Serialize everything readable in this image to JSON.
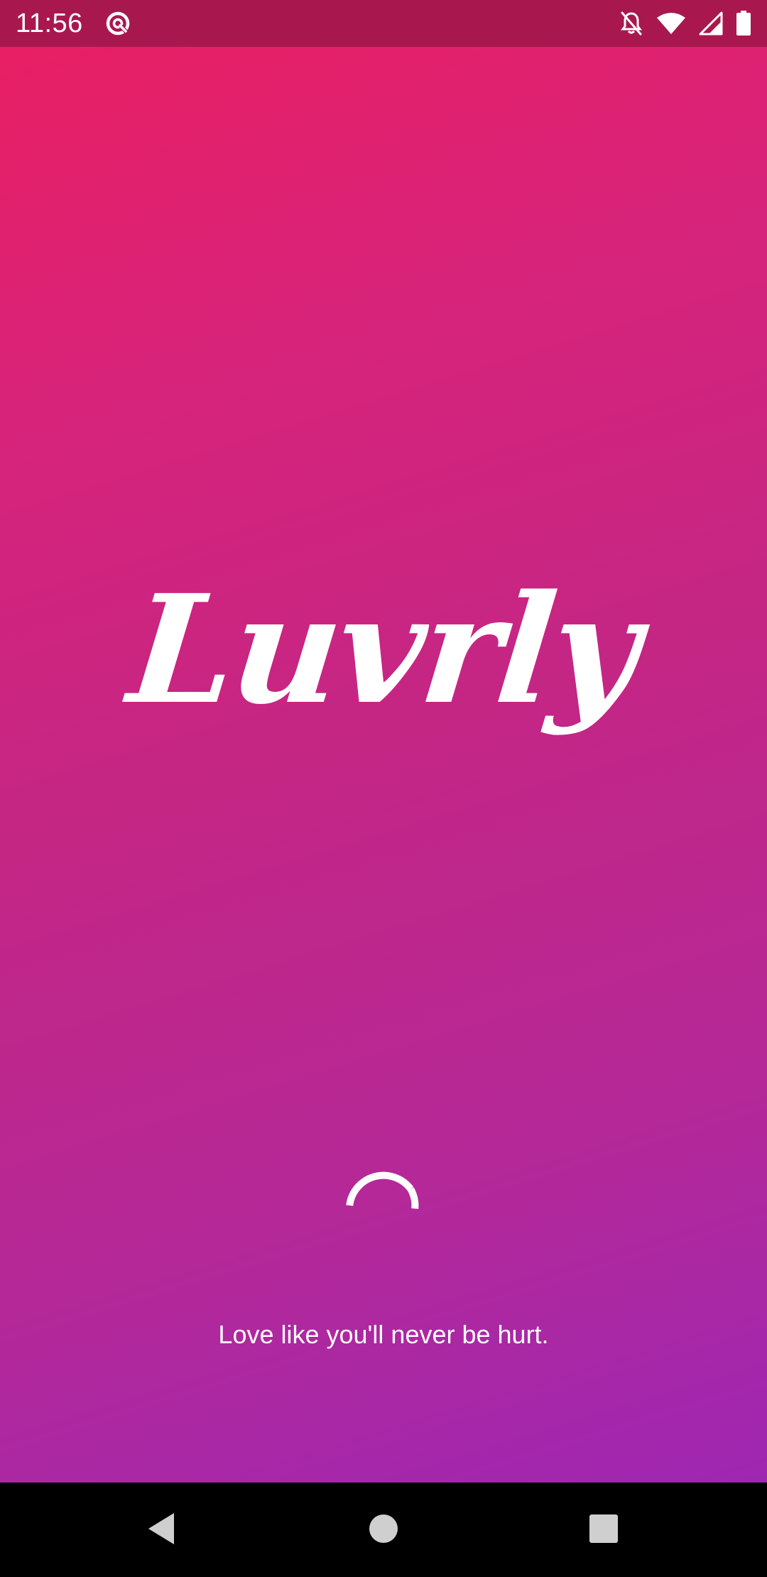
{
  "status_bar": {
    "time": "11:56",
    "left_icons": [
      "data-saver-icon"
    ],
    "right_icons": [
      "notifications-off-icon",
      "wifi-icon",
      "signal-icon",
      "battery-icon"
    ],
    "background_color": "#a8184e"
  },
  "splash": {
    "logo_text": "Luvrly",
    "tagline": "Love like you'll never be hurt.",
    "loading": true,
    "gradient_colors": [
      "#e81f63",
      "#9e27b2"
    ]
  },
  "nav_bar": {
    "buttons": [
      "back-icon",
      "home-icon",
      "recents-icon"
    ]
  }
}
